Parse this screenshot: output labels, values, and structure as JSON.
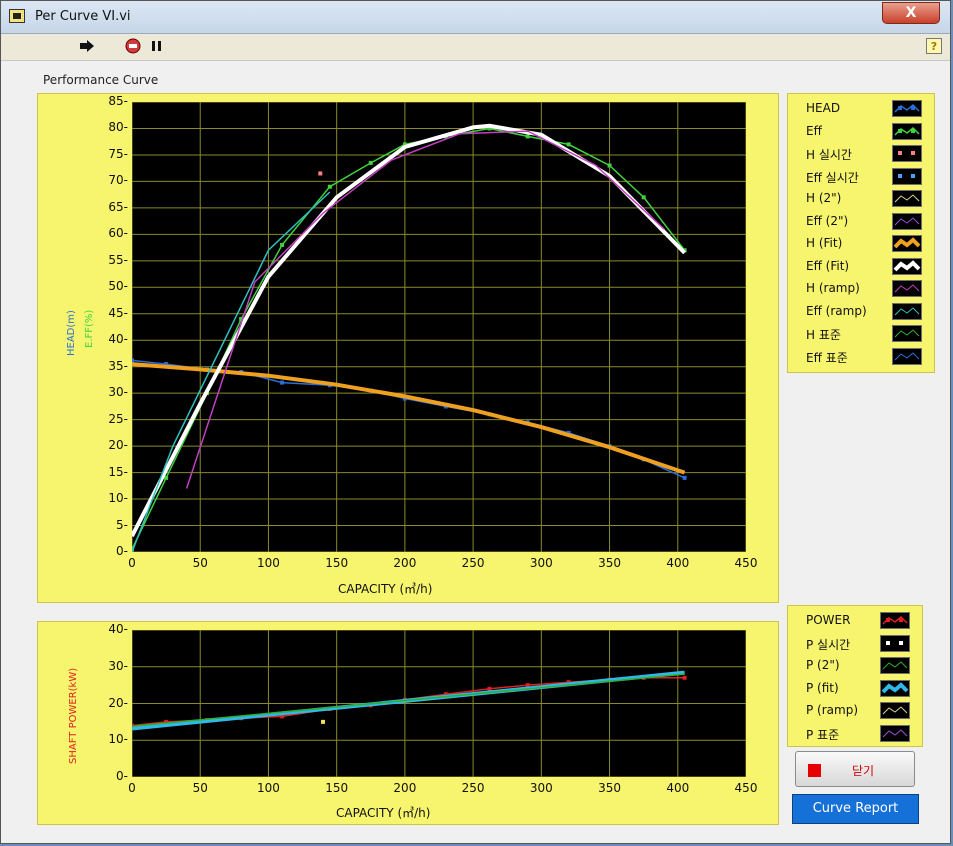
{
  "window": {
    "title": "Per Curve VI.vi",
    "close_glyph": "X"
  },
  "toolbar": {
    "run_icon": "run-arrow-icon",
    "abort_icon": "abort-stop-icon",
    "pause_icon": "pause-icon",
    "help_glyph": "?"
  },
  "plot_label": "Performance Curve",
  "top_chart": {
    "chart_data": {
      "type": "line",
      "xlabel": "CAPACITY (㎥/h)",
      "ylabel_head": "HEAD(m)",
      "ylabel_eff": "E.FF(%)",
      "xlim": [
        0,
        450
      ],
      "ylim": [
        0,
        85
      ],
      "xticks": [
        0,
        50,
        100,
        150,
        200,
        250,
        300,
        350,
        400,
        450
      ],
      "yticks": [
        0,
        5,
        10,
        15,
        20,
        25,
        30,
        35,
        40,
        45,
        50,
        55,
        60,
        65,
        70,
        75,
        80,
        85
      ],
      "grid": true,
      "series": [
        {
          "name": "HEAD",
          "color": "#2a6fd8",
          "x": [
            0,
            25,
            55,
            80,
            110,
            145,
            175,
            200,
            230,
            262,
            290,
            320,
            350,
            375,
            405
          ],
          "y": [
            36.2,
            35.5,
            34.5,
            34.0,
            32.0,
            31.5,
            30.5,
            29.0,
            27.5,
            26.0,
            24.5,
            22.5,
            20.0,
            17.5,
            14.0
          ]
        },
        {
          "name": "Eff",
          "color": "#3fd23f",
          "x": [
            0,
            25,
            55,
            80,
            110,
            145,
            175,
            200,
            230,
            262,
            290,
            320,
            350,
            375,
            405
          ],
          "y": [
            0.5,
            14,
            30,
            44,
            58,
            69,
            73.5,
            77,
            78.5,
            80,
            78.5,
            77,
            73,
            67,
            57
          ]
        },
        {
          "name": "H 실시간",
          "color": "#ff8080",
          "x": [
            138
          ],
          "y": [
            71.5
          ]
        },
        {
          "name": "H (Fit)",
          "color": "#f0a020",
          "x": [
            0,
            50,
            100,
            150,
            200,
            250,
            300,
            350,
            405
          ],
          "y": [
            35.5,
            34.5,
            33.3,
            31.6,
            29.4,
            26.8,
            23.6,
            19.8,
            15.0
          ]
        },
        {
          "name": "Eff (Fit)",
          "color": "#ffffff",
          "x": [
            0,
            50,
            100,
            150,
            200,
            250,
            262,
            300,
            350,
            405
          ],
          "y": [
            3,
            28,
            52,
            67,
            76.5,
            80.2,
            80.5,
            78.8,
            71,
            56.5
          ]
        },
        {
          "name": "Eff (ramp)",
          "color": "#30c0c0",
          "x": [
            0,
            30,
            100,
            145
          ],
          "y": [
            0,
            20,
            57,
            68
          ]
        },
        {
          "name": "H (ramp)",
          "color": "#c040c0",
          "x": [
            40,
            90,
            140,
            190,
            240,
            290,
            340,
            390
          ],
          "y": [
            12,
            51,
            64,
            74,
            79,
            79.5,
            73,
            61
          ]
        }
      ]
    },
    "legend": [
      {
        "name": "HEAD",
        "color": "#2a6fd8",
        "style": "line-dot"
      },
      {
        "name": "Eff",
        "color": "#3fd23f",
        "style": "line-dot"
      },
      {
        "name": "H 실시간",
        "color": "#ff8080",
        "style": "dots"
      },
      {
        "name": "Eff 실시간",
        "color": "#4aa0ff",
        "style": "dots"
      },
      {
        "name": "H (2\")",
        "color": "#d4d48a",
        "style": "thin"
      },
      {
        "name": "Eff (2\")",
        "color": "#9a50d8",
        "style": "thin"
      },
      {
        "name": "H (Fit)",
        "color": "#f0a020",
        "style": "thick"
      },
      {
        "name": "Eff (Fit)",
        "color": "#ffffff",
        "style": "thick"
      },
      {
        "name": "H (ramp)",
        "color": "#c040c0",
        "style": "thin"
      },
      {
        "name": "Eff (ramp)",
        "color": "#30c0c0",
        "style": "thin"
      },
      {
        "name": "H 표준",
        "color": "#2fae2f",
        "style": "thin"
      },
      {
        "name": "Eff 표준",
        "color": "#2a6fd8",
        "style": "thin"
      }
    ]
  },
  "bottom_chart": {
    "chart_data": {
      "type": "line",
      "xlabel": "CAPACITY (㎥/h)",
      "ylabel": "SHAFT POWER(kW)",
      "xlim": [
        0,
        450
      ],
      "ylim": [
        0,
        40
      ],
      "xticks": [
        0,
        50,
        100,
        150,
        200,
        250,
        300,
        350,
        400,
        450
      ],
      "yticks": [
        0,
        10,
        20,
        30,
        40
      ],
      "grid": true,
      "series": [
        {
          "name": "POWER",
          "color": "#e02020",
          "x": [
            0,
            25,
            55,
            80,
            110,
            145,
            175,
            200,
            230,
            262,
            290,
            320,
            350,
            375,
            405
          ],
          "y": [
            14,
            15,
            15.5,
            16,
            16.5,
            18.5,
            19.5,
            21,
            22.5,
            24,
            25,
            25.8,
            26.5,
            27,
            27
          ]
        },
        {
          "name": "P 실시간",
          "color": "#f0e060",
          "x": [
            140
          ],
          "y": [
            15
          ]
        },
        {
          "name": "P (fit)",
          "color": "#30b8e8",
          "x": [
            0,
            405
          ],
          "y": [
            13.2,
            28.4
          ]
        },
        {
          "name": "P (2\")",
          "color": "#2fae2f",
          "x": [
            0,
            405
          ],
          "y": [
            13.8,
            28.0
          ]
        }
      ]
    },
    "legend": [
      {
        "name": "POWER",
        "color": "#e02020",
        "style": "line-dot"
      },
      {
        "name": "P 실시간",
        "color": "#ffffff",
        "style": "dots"
      },
      {
        "name": "P (2\")",
        "color": "#2fae2f",
        "style": "thin"
      },
      {
        "name": "P (fit)",
        "color": "#30b8e8",
        "style": "thick"
      },
      {
        "name": "P (ramp)",
        "color": "#d4d48a",
        "style": "thin"
      },
      {
        "name": "P 표준",
        "color": "#9a50d8",
        "style": "thin"
      }
    ]
  },
  "buttons": {
    "close_label": "닫기",
    "report_label": "Curve Report"
  }
}
